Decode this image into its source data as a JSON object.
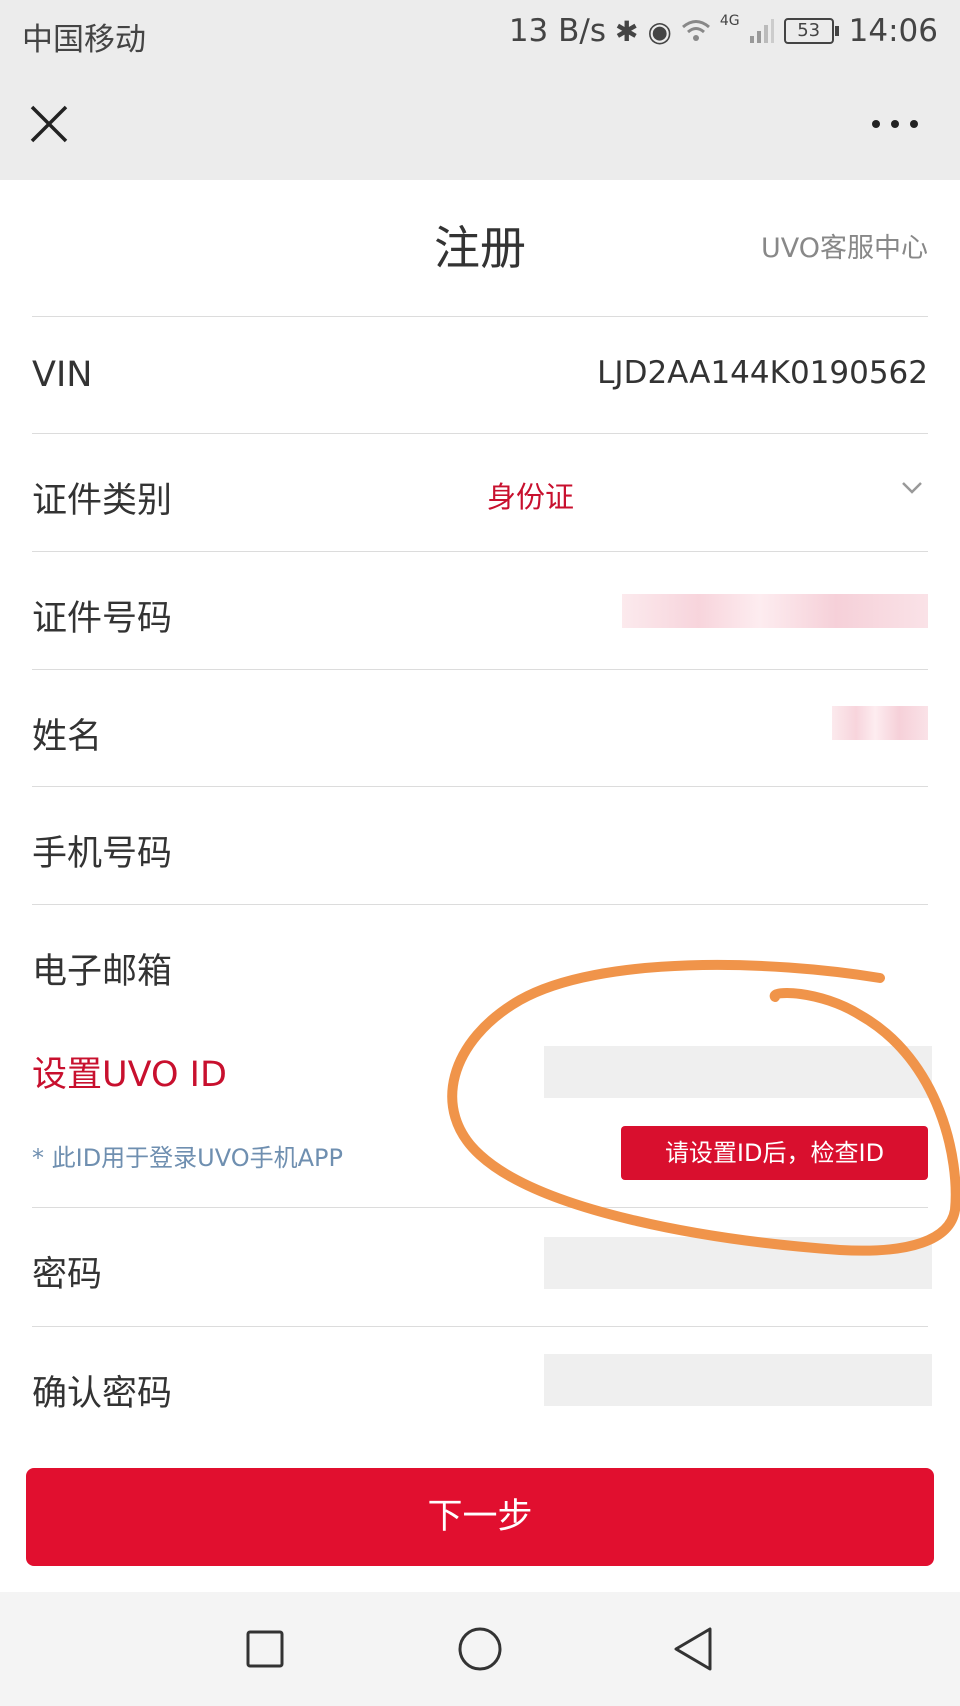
{
  "status_bar": {
    "carrier": "中国移动",
    "net_speed": "13 B/s",
    "network": "4G",
    "battery": "53",
    "time": "14:06"
  },
  "nav": {
    "close_icon": "close-icon",
    "more_icon": "more-icon"
  },
  "header": {
    "title": "注册",
    "service_link": "UVO客服中心"
  },
  "form": {
    "vin": {
      "label": "VIN",
      "value": "LJD2AA144K0190562"
    },
    "id_type": {
      "label": "证件类别",
      "value": "身份证"
    },
    "id_number": {
      "label": "证件号码"
    },
    "name": {
      "label": "姓名"
    },
    "phone": {
      "label": "手机号码"
    },
    "email": {
      "label": "电子邮箱"
    },
    "uvo_id": {
      "label": "设置UVO ID",
      "hint": "* 此ID用于登录UVO手机APP",
      "check_button": "请设置ID后，检查ID"
    },
    "password": {
      "label": "密码"
    },
    "confirm_password": {
      "label": "确认密码"
    }
  },
  "next_button": "下一步",
  "colors": {
    "accent_red": "#e10f2f",
    "annotation_orange": "#f0944a"
  }
}
